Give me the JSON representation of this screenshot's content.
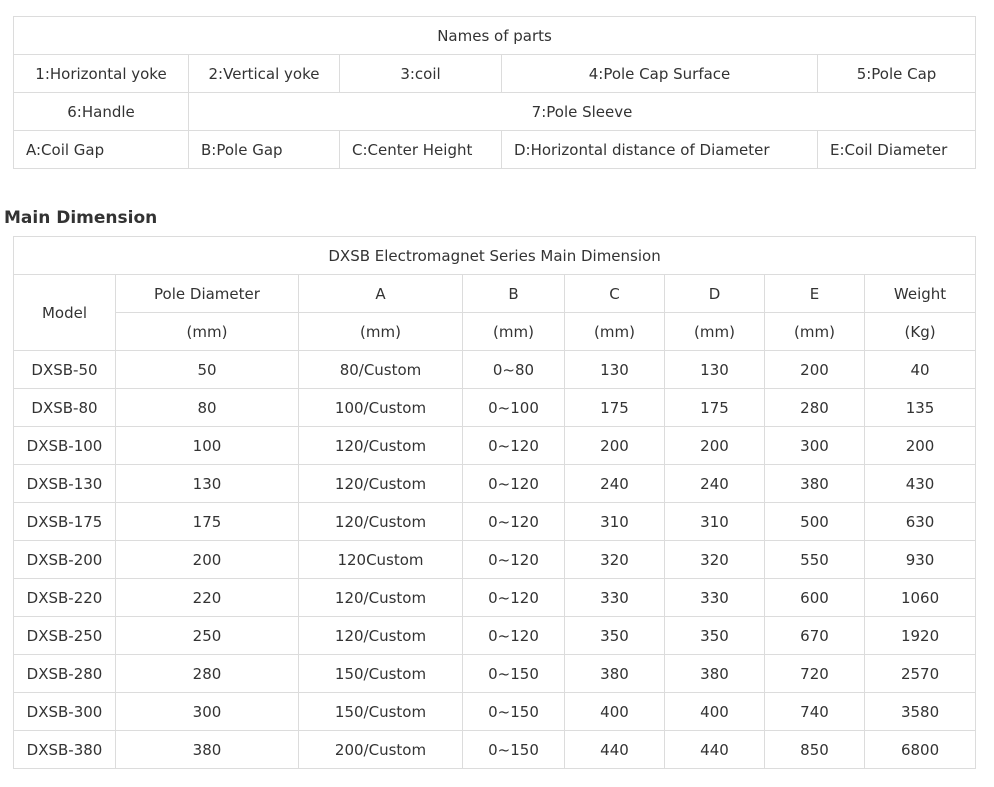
{
  "parts": {
    "title": "Names of parts",
    "row1": [
      "1:Horizontal yoke",
      "2:Vertical yoke",
      "3:coil",
      "4:Pole Cap Surface",
      "5:Pole Cap"
    ],
    "row2": [
      "6:Handle",
      "7:Pole Sleeve"
    ],
    "row3": [
      "A:Coil Gap",
      "B:Pole Gap",
      "C:Center Height",
      "D:Horizontal distance of Diameter",
      "E:Coil Diameter"
    ]
  },
  "section_heading": "Main Dimension",
  "dimensions": {
    "title": "DXSB Electromagnet Series Main Dimension",
    "model_header": "Model",
    "headers": [
      "Pole Diameter",
      "A",
      "B",
      "C",
      "D",
      "E",
      "Weight"
    ],
    "units": [
      "(mm)",
      "(mm)",
      "(mm)",
      "(mm)",
      "(mm)",
      "(mm)",
      "(Kg)"
    ],
    "rows": [
      [
        "DXSB-50",
        "50",
        "80/Custom",
        "0~80",
        "130",
        "130",
        "200",
        "40"
      ],
      [
        "DXSB-80",
        "80",
        "100/Custom",
        "0~100",
        "175",
        "175",
        "280",
        "135"
      ],
      [
        "DXSB-100",
        "100",
        "120/Custom",
        "0~120",
        "200",
        "200",
        "300",
        "200"
      ],
      [
        "DXSB-130",
        "130",
        "120/Custom",
        "0~120",
        "240",
        "240",
        "380",
        "430"
      ],
      [
        "DXSB-175",
        "175",
        "120/Custom",
        "0~120",
        "310",
        "310",
        "500",
        "630"
      ],
      [
        "DXSB-200",
        "200",
        "120Custom",
        "0~120",
        "320",
        "320",
        "550",
        "930"
      ],
      [
        "DXSB-220",
        "220",
        "120/Custom",
        "0~120",
        "330",
        "330",
        "600",
        "1060"
      ],
      [
        "DXSB-250",
        "250",
        "120/Custom",
        "0~120",
        "350",
        "350",
        "670",
        "1920"
      ],
      [
        "DXSB-280",
        "280",
        "150/Custom",
        "0~150",
        "380",
        "380",
        "720",
        "2570"
      ],
      [
        "DXSB-300",
        "300",
        "150/Custom",
        "0~150",
        "400",
        "400",
        "740",
        "3580"
      ],
      [
        "DXSB-380",
        "380",
        "200/Custom",
        "0~150",
        "440",
        "440",
        "850",
        "6800"
      ]
    ]
  }
}
